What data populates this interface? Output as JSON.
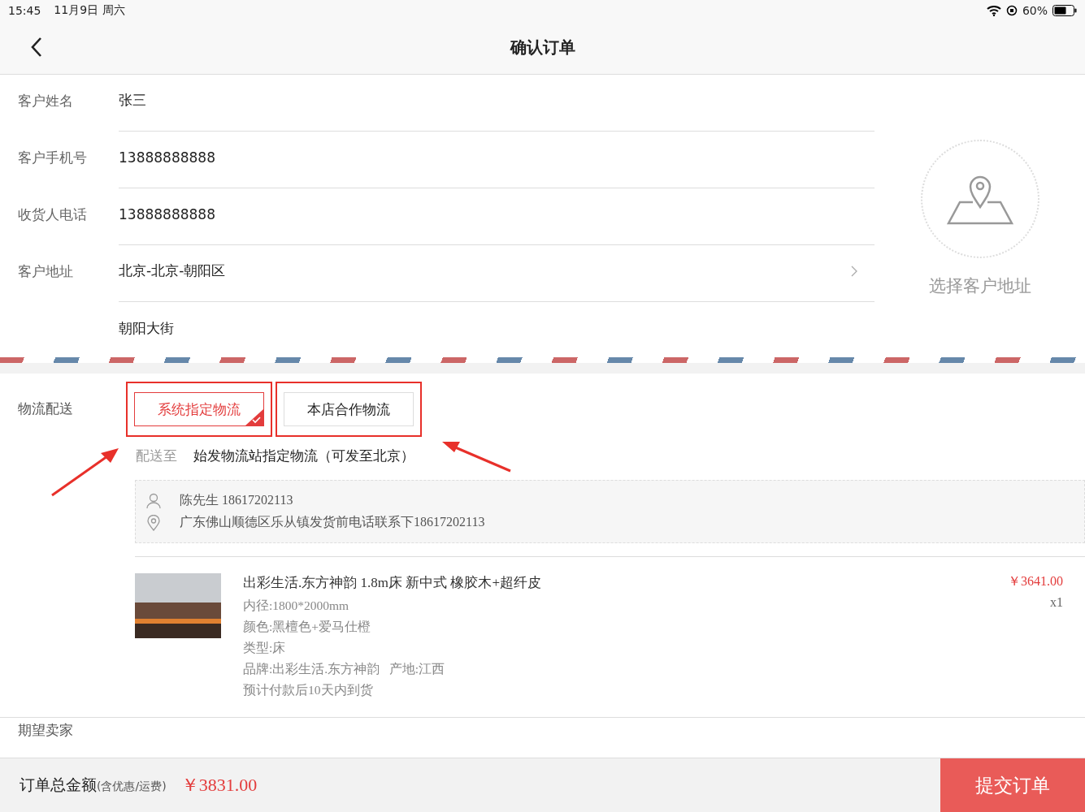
{
  "status_bar": {
    "time": "15:45",
    "date": "11月9日 周六",
    "battery": "60%"
  },
  "nav": {
    "title": "确认订单"
  },
  "customer_fields": [
    {
      "label": "客户姓名",
      "value": "张三",
      "kind": "text"
    },
    {
      "label": "客户手机号",
      "value": "13888888888",
      "kind": "text"
    },
    {
      "label": "收货人电话",
      "value": "13888888888",
      "kind": "text"
    },
    {
      "label": "客户地址",
      "value": "北京-北京-朝阳区",
      "kind": "select"
    },
    {
      "value": "朝阳大街",
      "kind": "text"
    }
  ],
  "address_picker": {
    "label": "选择客户地址"
  },
  "logistics": {
    "label": "物流配送",
    "options": [
      {
        "label": "系统指定物流",
        "selected": true
      },
      {
        "label": "本店合作物流",
        "selected": false
      }
    ],
    "delivery_label": "配送至",
    "delivery_value": "始发物流站指定物流（可发至北京）",
    "sender": {
      "contact": "陈先生 18617202113",
      "address": "广东佛山顺德区乐从镇发货前电话联系下18617202113"
    }
  },
  "product": {
    "title": "出彩生活.东方神韵 1.8m床 新中式 橡胶木+超纤皮",
    "specs": [
      "内径:1800*2000mm",
      "颜色:黑檀色+爱马仕橙",
      "类型:床",
      "品牌:出彩生活.东方神韵   产地:江西",
      "预计付款后10天内到货"
    ],
    "price": "￥3641.00",
    "quantity": "x1"
  },
  "expected_seller": {
    "label": "期望卖家"
  },
  "footer": {
    "total_label": "订单总金额",
    "total_note": "(含优惠/运费)",
    "total": "￥3831.00",
    "submit": "提交订单"
  }
}
